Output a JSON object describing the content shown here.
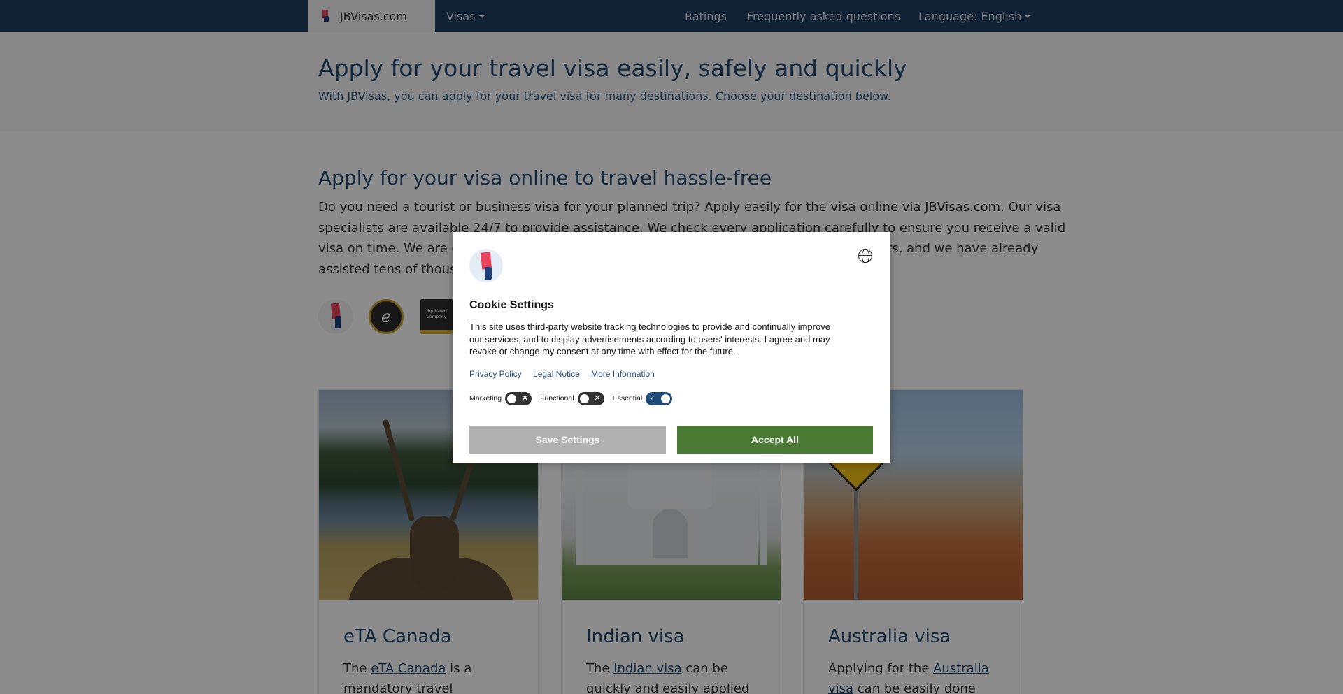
{
  "nav": {
    "brand": "JBVisas.com",
    "visas": "Visas",
    "ratings": "Ratings",
    "faq": "Frequently asked questions",
    "language": "Language: English"
  },
  "hero": {
    "title": "Apply for your travel visa easily, safely and quickly",
    "subtitle": "With JBVisas, you can apply for your travel visa for many destinations. Choose your destination below."
  },
  "main": {
    "title": "Apply for your visa online to travel hassle-free",
    "text_lines": [
      "Do you need a tourist or business visa for your planned trip? Apply easily for the visa online via JBVisas.com. Our visa",
      "specialists are available 24/7 to provide assistance. We check every application carefully to ensure you receive a valid",
      "visa on time. We are certified by Trusted Shops and rated with \"Excellent\" by our customers, and we have already",
      "assisted tens of thousands of travelers with their visa applications."
    ],
    "badge_rated_text": "Top Rated Company"
  },
  "cards": [
    {
      "title": "eTA Canada",
      "pre": "The ",
      "link": "eTA Canada",
      "post": " is a mandatory travel"
    },
    {
      "title": "Indian visa",
      "pre": "The ",
      "link": "Indian visa",
      "post": " can be quickly and easily applied for"
    },
    {
      "title": "Australia visa",
      "pre": "Applying for the ",
      "link": "Australia visa",
      "post": " can be easily done"
    }
  ],
  "cookie": {
    "title": "Cookie Settings",
    "body_lines": [
      "This site uses third-party website tracking technologies to provide and continually improve",
      "our services, and to display advertisements according to users' interests. I agree and may",
      "revoke or change my consent at any time with effect for the future."
    ],
    "links": [
      "Privacy Policy",
      "Legal Notice",
      "More Information"
    ],
    "toggles": [
      {
        "label": "Marketing",
        "on": false
      },
      {
        "label": "Functional",
        "on": false
      },
      {
        "label": "Essential",
        "on": true
      }
    ],
    "save_label": "Save Settings",
    "accept_label": "Accept All"
  },
  "colors": {
    "navbar": "#1f3f5f",
    "heading": "#1f4a72",
    "accept": "#4a7a33",
    "save": "#b1b1b1"
  }
}
